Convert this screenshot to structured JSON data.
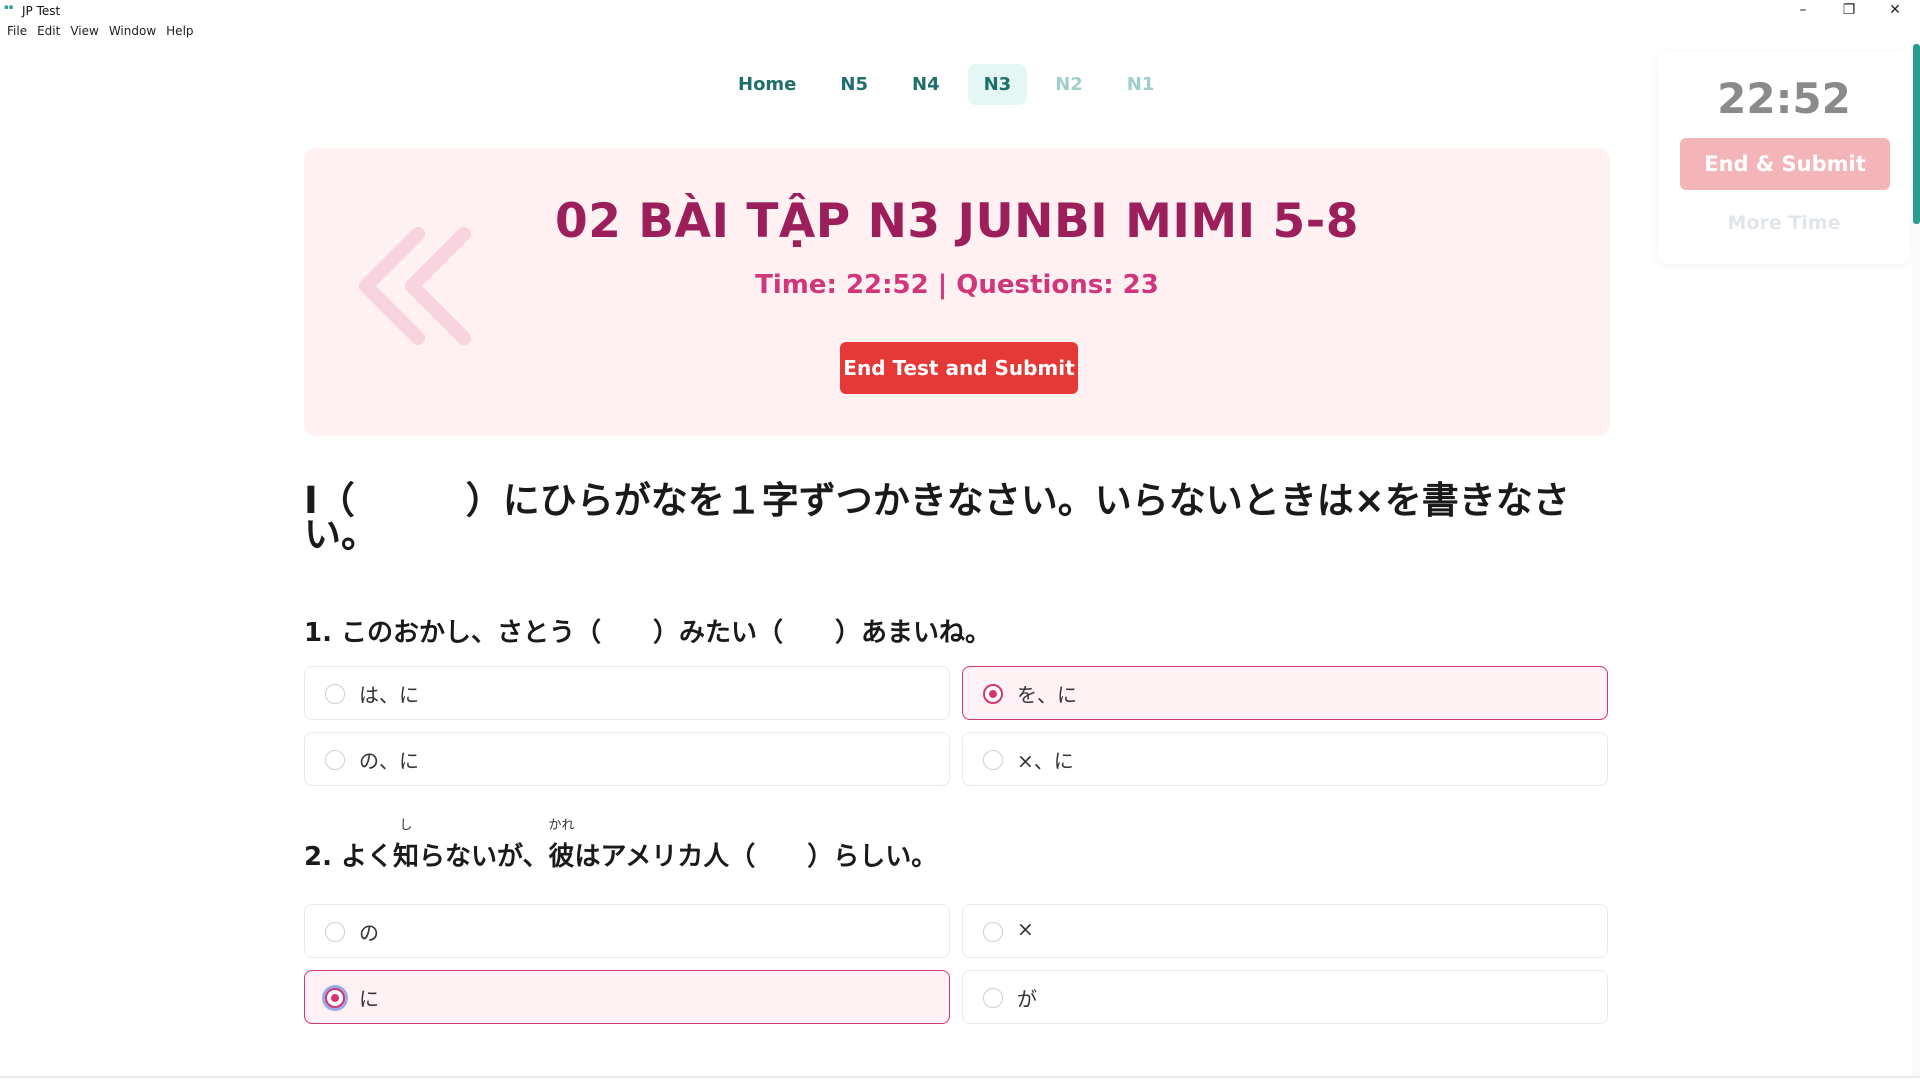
{
  "window": {
    "title": "JP Test",
    "icon_text": "JP\nTest",
    "minimize": "–",
    "maximize": "❐",
    "close": "✕"
  },
  "menu": [
    "File",
    "Edit",
    "View",
    "Window",
    "Help"
  ],
  "nav": {
    "items": [
      {
        "label": "Home",
        "state": "normal"
      },
      {
        "label": "N5",
        "state": "normal"
      },
      {
        "label": "N4",
        "state": "normal"
      },
      {
        "label": "N3",
        "state": "active"
      },
      {
        "label": "N2",
        "state": "dim"
      },
      {
        "label": "N1",
        "state": "dim"
      }
    ]
  },
  "timer_panel": {
    "time": "22:52",
    "end_submit": "End & Submit",
    "more_time": "More Time"
  },
  "hero": {
    "title": "02 BÀI TẬP N3 JUNBI MIMI 5-8",
    "subtitle": "Time: 22:52 | Questions: 23",
    "button": "End Test and Submit"
  },
  "section": {
    "heading": "I（　　　）にひらがなを１字ずつかきなさい。いらないときは×を書きなさい。"
  },
  "questions": [
    {
      "text": "1. このおかし、さとう（　　）みたい（　　）あまいね。",
      "options": [
        {
          "label": "は、に",
          "selected": false
        },
        {
          "label": "を、に",
          "selected": true
        },
        {
          "label": "の、に",
          "selected": false
        },
        {
          "label": "×、に",
          "selected": false
        }
      ]
    },
    {
      "text_before": "2. よく",
      "ruby1_base": "知",
      "ruby1_rt": "し",
      "text_mid": "らないが、",
      "ruby2_base": "彼",
      "ruby2_rt": "かれ",
      "text_after": "はアメリカ人（　　）らしい。",
      "options": [
        {
          "label": "の",
          "selected": false
        },
        {
          "label": "×",
          "selected": false
        },
        {
          "label": "に",
          "selected": true
        },
        {
          "label": "が",
          "selected": false
        }
      ]
    }
  ],
  "colors": {
    "accent": "#d3376f",
    "brand_teal": "#2a9d8f",
    "hero_title": "#9c1f5c",
    "submit_red": "#e53937"
  }
}
